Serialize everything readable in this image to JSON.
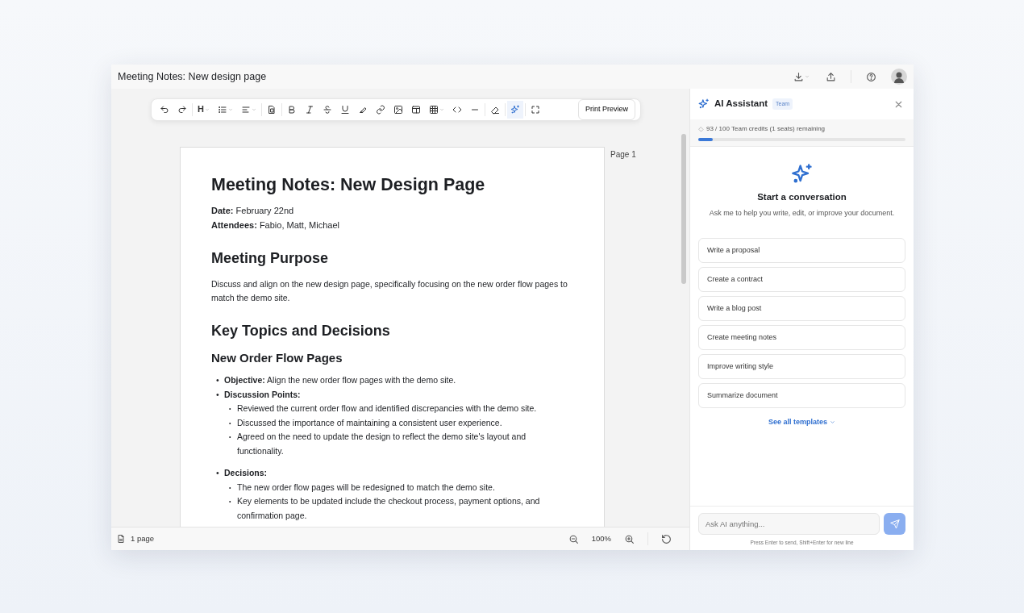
{
  "window": {
    "title": "Meeting Notes: New design page"
  },
  "toolbar": {
    "heading_label": "H",
    "ai_active": true,
    "print_button": "Print Preview"
  },
  "document": {
    "page_label": "Page 1",
    "blocks": [
      {
        "kind": "h1",
        "text": "Meeting Notes: New Design Page"
      },
      {
        "kind": "meta",
        "lines": [
          "**Date:** February 22nd",
          "**Attendees:** Fabio, Matt, Michael"
        ]
      },
      {
        "kind": "h2",
        "text": "Meeting Purpose"
      },
      {
        "kind": "p",
        "text": "Discuss and align on the new design page, specifically focusing on the new order flow pages to match the demo site."
      },
      {
        "kind": "h2",
        "text": "Key Topics and Decisions"
      },
      {
        "kind": "h3",
        "text": "New Order Flow Pages"
      },
      {
        "kind": "list",
        "items": [
          {
            "marker": "•",
            "text": "**Objective:** Align the new order flow pages with the demo site."
          },
          {
            "marker": "•",
            "text": "**Discussion Points:**",
            "children": [
              {
                "marker": "•",
                "text": "Reviewed the current order flow and identified discrepancies with the demo site."
              },
              {
                "marker": "•",
                "text": "Discussed the importance of maintaining a consistent user experience."
              },
              {
                "marker": "•",
                "text": "Agreed on the need to update the design to reflect the demo site's layout and functionality."
              }
            ]
          },
          {
            "marker": "•",
            "text": "**Decisions:**",
            "children": [
              {
                "marker": "•",
                "text": "The new order flow pages will be redesigned to match the demo site."
              },
              {
                "marker": "•",
                "text": "Key elements to be updated include the checkout process, payment options, and confirmation page."
              }
            ]
          }
        ]
      }
    ]
  },
  "status_bar": {
    "pages": "1 page",
    "zoom": "100%"
  },
  "assistant": {
    "title": "AI Assistant",
    "plan_badge": "Team",
    "credits_text": "93 / 100 Team credits (1 seats) remaining",
    "credits": {
      "level": 0.07
    },
    "empty_title": "Start a conversation",
    "empty_subtitle": "Ask me to help you write, edit, or improve your document.",
    "templates": [
      "Write a proposal",
      "Create a contract",
      "Write a blog post",
      "Create meeting notes",
      "Improve writing style",
      "Summarize document"
    ],
    "see_all": "See all templates",
    "input": {
      "placeholder": "Ask AI anything..."
    },
    "hint": "Press Enter to send, Shift+Enter for new line"
  }
}
